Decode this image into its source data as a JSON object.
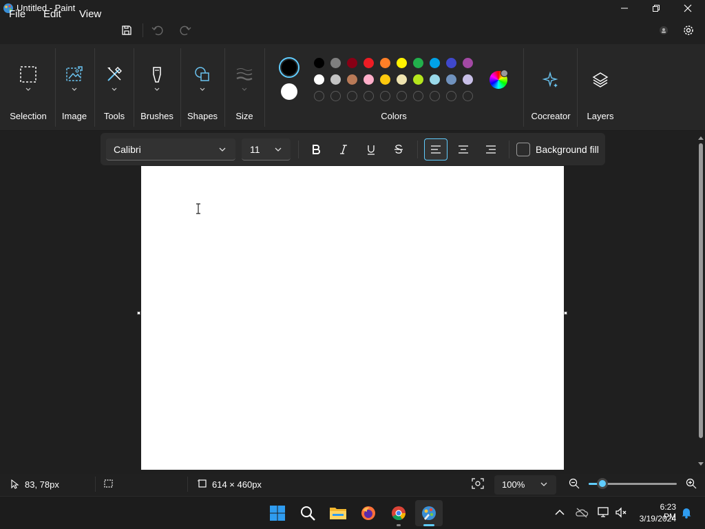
{
  "window": {
    "title": "Untitled - Paint",
    "icons": {
      "app": "paint-app-icon",
      "minimize": "minimize-icon",
      "maximize": "restore-icon",
      "close": "close-icon"
    }
  },
  "menu": {
    "file": "File",
    "edit": "Edit",
    "view": "View",
    "icons": {
      "save": "save-icon",
      "undo": "undo-icon",
      "redo": "redo-icon",
      "account": "account-icon",
      "settings": "gear-icon"
    }
  },
  "ribbon": {
    "groups": [
      {
        "label": "Selection",
        "icon": "selection-rectangle-icon"
      },
      {
        "label": "Image",
        "icon": "image-icon"
      },
      {
        "label": "Tools",
        "icon": "tools-icon"
      },
      {
        "label": "Brushes",
        "icon": "brush-icon"
      },
      {
        "label": "Shapes",
        "icon": "shapes-icon"
      },
      {
        "label": "Size",
        "icon": "stroke-size-icon"
      },
      {
        "label": "Colors",
        "icon": "palette"
      },
      {
        "label": "Cocreator",
        "icon": "sparkle-icon"
      },
      {
        "label": "Layers",
        "icon": "layers-icon"
      }
    ],
    "colors": {
      "primary": "#000000",
      "secondary": "#ffffff",
      "row1": [
        "#000000",
        "#7f7f7f",
        "#880015",
        "#ed1c24",
        "#ff7f27",
        "#fff200",
        "#22b14c",
        "#00a2e8",
        "#3f48cc",
        "#a349a4"
      ],
      "row2": [
        "#ffffff",
        "#c3c3c3",
        "#b97a57",
        "#ffaec9",
        "#ffc90e",
        "#efe4b0",
        "#b5e61d",
        "#99d9ea",
        "#7092be",
        "#c8bfe7"
      ],
      "custom_slots": 10
    }
  },
  "text_toolbar": {
    "font": "Calibri",
    "size": "11",
    "icons": {
      "bold": "bold-icon",
      "italic": "italic-icon",
      "underline": "underline-icon",
      "strike": "strikethrough-icon",
      "align_left": "align-left-icon",
      "align_center": "align-center-icon",
      "align_right": "align-right-icon"
    },
    "selected_alignment": "left",
    "background_fill_label": "Background fill",
    "background_fill_checked": false
  },
  "canvas": {
    "background": "#ffffff",
    "cursor": "text-cursor"
  },
  "statusbar": {
    "cursor_position": "83, 78px",
    "canvas_size": "614 × 460px",
    "zoom": "100%",
    "zoom_slider_fraction": 0.16
  },
  "taskbar": {
    "apps": [
      "windows-start",
      "search",
      "file-explorer",
      "firefox",
      "chrome",
      "paint"
    ],
    "active_app": "paint",
    "time": "6:23 PM",
    "date": "3/19/2024"
  },
  "accent": "#60cdff"
}
